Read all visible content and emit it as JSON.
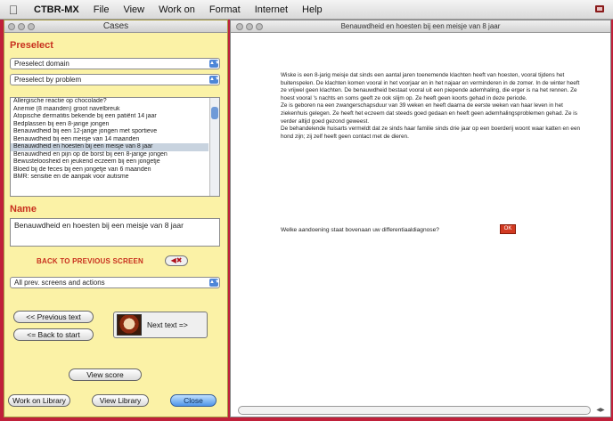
{
  "menubar": {
    "app_name": "CTBR-MX",
    "items": [
      "File",
      "View",
      "Work on",
      "Format",
      "Internet",
      "Help"
    ]
  },
  "left_window": {
    "title": "Cases",
    "preselect_label": "Preselect",
    "preselect_domain": "Preselect domain",
    "preselect_problem": "Preselect by problem",
    "cases": [
      "Allergische reactie op chocolade?",
      "Anemie (8 maanden) groot navelbreuk",
      "Atopische dermatitis bekende bij een patiënt 14 jaar",
      "Bedplassen bij een 8-jarige jongen",
      "Benauwdheid bij een 12-jarige jongen met sportieve",
      "Benauwdheid bij een meisje van 14 maanden",
      "Benauwdheid en hoesten bij een meisje van 8 jaar",
      "Benauwdheid en pijn op de borst bij een 8-jarige jongen",
      "Bewusteloosheid en jeukend eczeem bij een jongetje",
      "Bloed bij de feces bij een jongetje van 6 maanden",
      "BMR: sensitie en de aanpak voor autisme"
    ],
    "selected_index": 6,
    "name_label": "Name",
    "name_value": "Benauwdheid en hoesten bij een meisje van 8 jaar",
    "back_prev_screen": "BACK TO PREVIOUS SCREEN",
    "all_prev_select": "All prev. screens and actions",
    "prev_text_btn": "<< Previous text",
    "back_start_btn": "<= Back to start",
    "next_text_btn": "Next text =>",
    "view_score_btn": "View score",
    "work_library_btn": "Work on Library",
    "view_library_btn": "View Library",
    "close_btn": "Close"
  },
  "right_window": {
    "title": "Benauwdheid en hoesten bij een meisje van 8 jaar",
    "paragraphs": [
      "Wiske is een 8-jarig meisje dat sinds een aantal jaren toenemende klachten heeft van hoesten, vooral tijdens het buitenspelen. De klachten komen vooral in het voorjaar en in het najaar en verminderen in de zomer. In de winter heeft ze vrijwel geen klachten. De benauwdheid bestaat vooral uit een piepende ademhaling, die erger is na het rennen. Ze hoest vooral 's nachts en soms geeft ze ook slijm op. Ze heeft geen koorts gehad in deze periode.",
      "Ze is geboren na een zwangerschapsduur van 39 weken en heeft daarna de eerste weken van haar leven in het ziekenhuis gelegen. Ze heeft het eczeem dat steeds goed gedaan en heeft geen ademhalingsproblemen gehad. Ze is verder altijd goed gezond geweest.",
      "De behandelende huisarts vermeldt dat ze sinds haar familie sinds drie jaar op een boerderij woont waar katten en een hond zijn; zij zelf heeft geen contact met de dieren."
    ],
    "question": "Welke aandoening staat bovenaan uw differentiaaldiagnose?",
    "ok_label": "OK"
  }
}
